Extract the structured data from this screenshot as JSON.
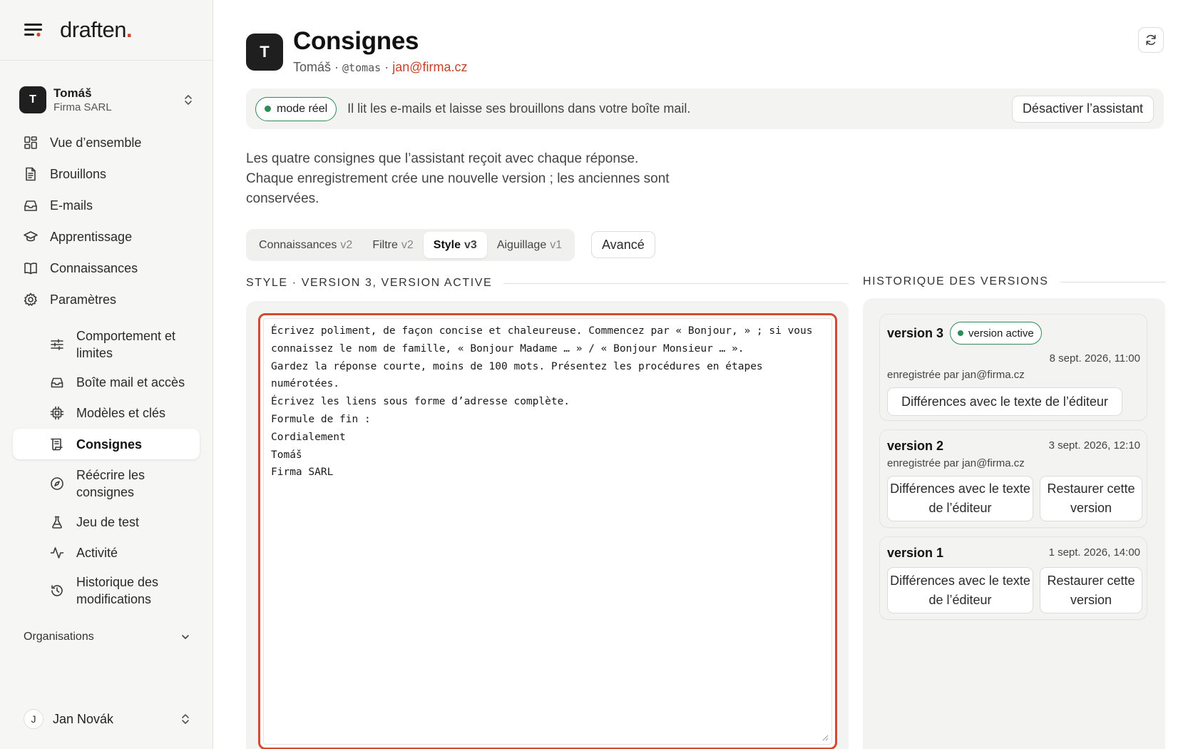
{
  "brand": {
    "name": "draften",
    "dot": "."
  },
  "account": {
    "initial": "T",
    "name": "Tomáš",
    "org": "Firma SARL"
  },
  "nav": {
    "items": [
      {
        "label": "Vue d’ensemble"
      },
      {
        "label": "Brouillons"
      },
      {
        "label": "E-mails"
      },
      {
        "label": "Apprentissage"
      },
      {
        "label": "Connaissances"
      },
      {
        "label": "Paramètres"
      }
    ],
    "sub_items": [
      {
        "label": "Comportement et limites"
      },
      {
        "label": "Boîte mail et accès"
      },
      {
        "label": "Modèles et clés"
      },
      {
        "label": "Consignes"
      },
      {
        "label": "Réécrire les consignes"
      },
      {
        "label": "Jeu de test"
      },
      {
        "label": "Activité"
      },
      {
        "label": "Historique des modifications"
      }
    ]
  },
  "organisations_label": "Organisations",
  "footer_user": {
    "initial": "J",
    "name": "Jan Novák"
  },
  "header": {
    "initial": "T",
    "title": "Consignes",
    "user": "Tomáš",
    "sep": " · ",
    "handle": "@tomas",
    "email": "jan@firma.cz"
  },
  "banner": {
    "mode": "mode réel",
    "message": "Il lit les e-mails et laisse ses brouillons dans votre boîte mail.",
    "button": "Désactiver l’assistant"
  },
  "description": {
    "line1": "Les quatre consignes que l’assistant reçoit avec chaque réponse.",
    "line2": "Chaque enregistrement crée une nouvelle version ; les anciennes sont conservées."
  },
  "tabs": [
    {
      "label": "Connaissances",
      "version": "v2"
    },
    {
      "label": "Filtre",
      "version": "v2"
    },
    {
      "label": "Style",
      "version": "v3"
    },
    {
      "label": "Aiguillage",
      "version": "v1"
    }
  ],
  "advanced_button": "Avancé",
  "editor": {
    "heading": "STYLE · VERSION 3, VERSION ACTIVE",
    "content": "Écrivez poliment, de façon concise et chaleureuse. Commencez par « Bonjour, » ; si vous connaissez le nom de famille, « Bonjour Madame … » / « Bonjour Monsieur … ».\nGardez la réponse courte, moins de 100 mots. Présentez les procédures en étapes numérotées.\nÉcrivez les liens sous forme d’adresse complète.\nFormule de fin :\nCordialement\nTomáš\nFirma SARL"
  },
  "history": {
    "heading": "HISTORIQUE DES VERSIONS",
    "versions": [
      {
        "name": "version 3",
        "badge": "version active",
        "date": "8 sept. 2026, 11:00",
        "saved_by": "enregistrée par jan@firma.cz",
        "diff_button": "Différences avec le texte de l’éditeur"
      },
      {
        "name": "version 2",
        "date": "3 sept. 2026, 12:10",
        "saved_by": "enregistrée par jan@firma.cz",
        "diff_button": "Différences avec le texte de l’éditeur",
        "restore_button": "Restaurer cette version"
      },
      {
        "name": "version 1",
        "date": "1 sept. 2026, 14:00",
        "diff_button": "Différences avec le texte de l’éditeur",
        "restore_button": "Restaurer cette version"
      }
    ]
  },
  "colors": {
    "accent": "#d1432b",
    "editor_border": "#d44a2e",
    "status_green": "#2f8a55",
    "email_link": "#c5432b"
  }
}
